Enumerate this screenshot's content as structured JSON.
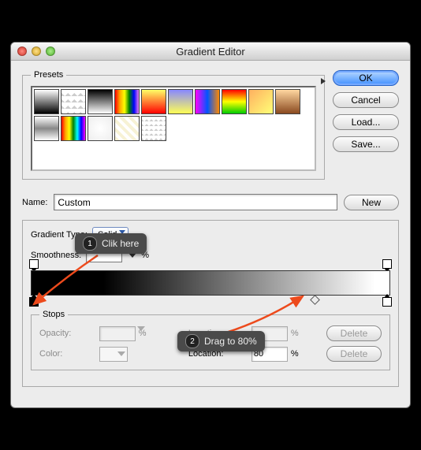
{
  "window": {
    "title": "Gradient Editor"
  },
  "buttons": {
    "ok": "OK",
    "cancel": "Cancel",
    "load": "Load...",
    "save": "Save...",
    "new": "New",
    "delete": "Delete"
  },
  "presets": {
    "legend": "Presets"
  },
  "name": {
    "label": "Name:",
    "value": "Custom"
  },
  "gradient": {
    "type_label": "Gradient Type:",
    "type_value": "Solid",
    "smoothness_label": "Smoothness:",
    "smoothness_value": "",
    "percent": "%"
  },
  "stops": {
    "legend": "Stops",
    "opacity_label": "Opacity:",
    "opacity_value": "",
    "color_label": "Color:",
    "location_label": "Location:",
    "location_opacity_value": "",
    "location_color_value": "80"
  },
  "annotations": {
    "step1": "Clik here",
    "step2": "Drag to 80%",
    "badge1": "1",
    "badge2": "2"
  },
  "chart_data": {
    "type": "gradient",
    "color_stops": [
      {
        "position_pct": 0,
        "color": "#000000"
      },
      {
        "position_pct": 80,
        "color": "#ffffff",
        "note": "target after drag"
      }
    ],
    "opacity_stops": [
      {
        "position_pct": 0,
        "opacity": 100
      },
      {
        "position_pct": 100,
        "opacity": 100
      }
    ]
  }
}
